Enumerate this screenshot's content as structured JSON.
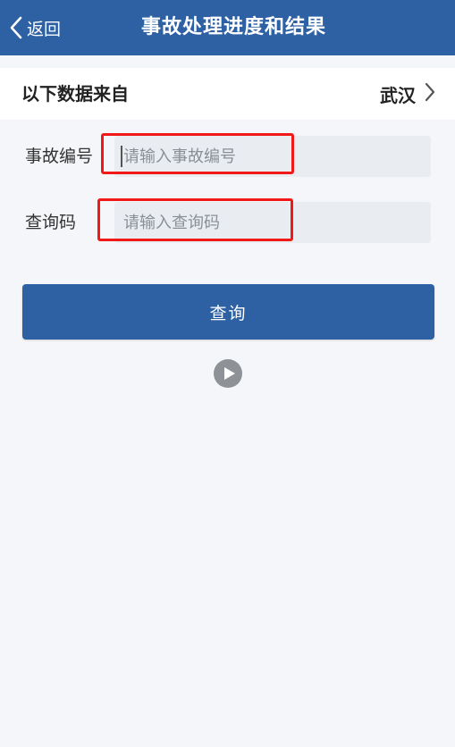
{
  "navbar": {
    "back_label": "返回",
    "title": "事故处理进度和结果",
    "bg_color": "#2d61a4"
  },
  "source": {
    "label": "以下数据来自",
    "city": "武汉",
    "chevron_icon": "chevron-right-icon"
  },
  "form": {
    "accident_no": {
      "label": "事故编号",
      "value": "",
      "placeholder": "请输入事故编号"
    },
    "query_code": {
      "label": "查询码",
      "value": "",
      "placeholder": "请输入查询码"
    },
    "highlight_color": "#f11818"
  },
  "query_button": {
    "label": "查询",
    "color": "#2d61a4"
  },
  "video": {
    "icon": "play-icon"
  }
}
